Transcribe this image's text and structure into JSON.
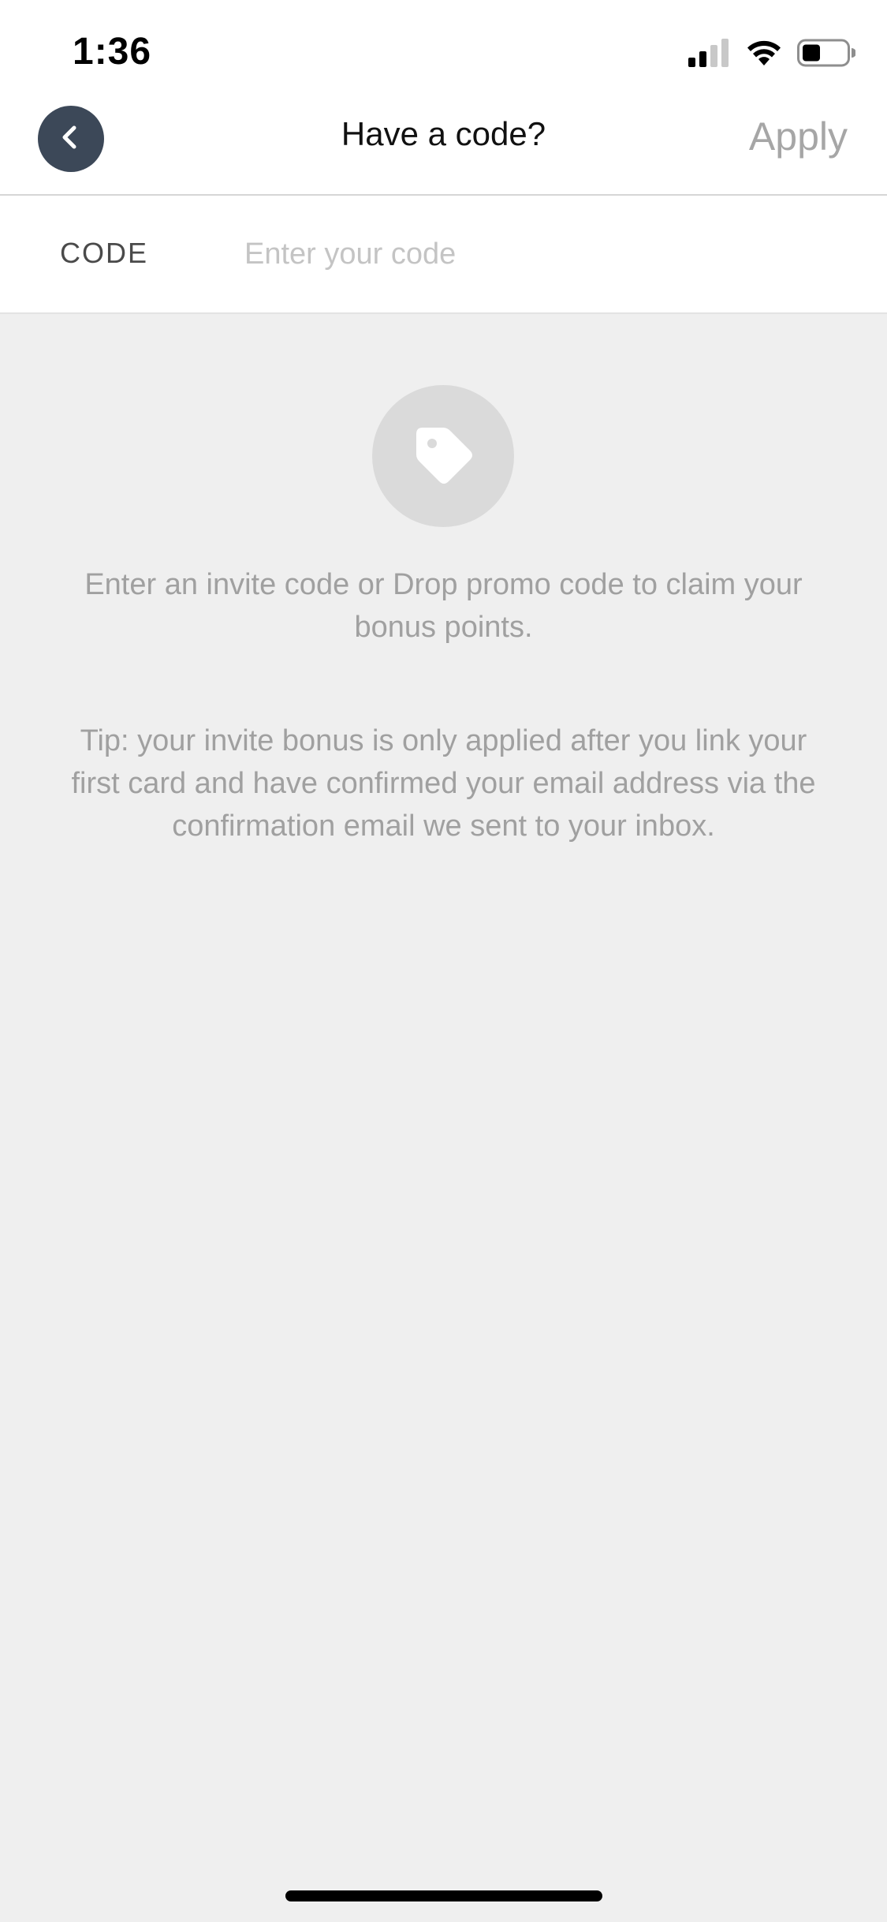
{
  "status_bar": {
    "time": "1:36",
    "icons": [
      "cellular-signal-icon",
      "wifi-icon",
      "battery-icon"
    ]
  },
  "nav": {
    "title": "Have a code?",
    "apply_label": "Apply",
    "back_icon": "chevron-left-icon"
  },
  "code_field": {
    "label": "CODE",
    "placeholder": "Enter your code",
    "value": ""
  },
  "content": {
    "icon": "tag-icon",
    "message": "Enter an invite code or Drop promo code to claim your bonus points.",
    "tip": "Tip: your invite bonus is only applied after you link your first card and have confirmed your email address via the confirmation email we sent to your inbox."
  },
  "colors": {
    "background": "#efefef",
    "back_button": "#3c4858",
    "apply_disabled": "#a6a6a6",
    "text_muted": "#a0a0a0"
  }
}
